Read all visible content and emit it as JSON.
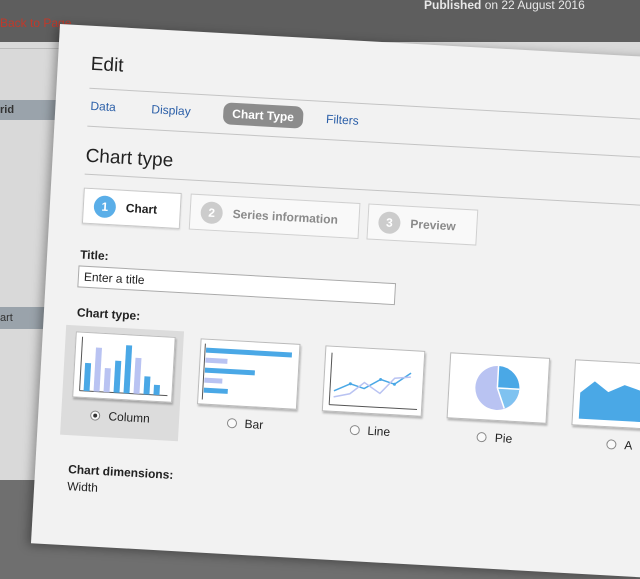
{
  "background": {
    "back_link": "Back to Page",
    "published_status": "Published",
    "published_date": "on 22 August 2016",
    "row_label_1": "rid",
    "row_label_2": "art"
  },
  "modal": {
    "title": "Edit",
    "tabs": [
      {
        "label": "Data",
        "active": false
      },
      {
        "label": "Display",
        "active": false
      },
      {
        "label": "Chart Type",
        "active": true
      },
      {
        "label": "Filters",
        "active": false
      }
    ],
    "section_title": "Chart type",
    "steps": [
      {
        "number": "1",
        "label": "Chart",
        "active": true
      },
      {
        "number": "2",
        "label": "Series information",
        "active": false
      },
      {
        "number": "3",
        "label": "Preview",
        "active": false
      }
    ],
    "title_field": {
      "label": "Title:",
      "placeholder": "Enter a title",
      "value": ""
    },
    "chart_type": {
      "label": "Chart type:",
      "selected": "Column",
      "options": [
        {
          "label": "Column",
          "icon": "column-chart-icon",
          "selected": true
        },
        {
          "label": "Bar",
          "icon": "bar-chart-icon",
          "selected": false
        },
        {
          "label": "Line",
          "icon": "line-chart-icon",
          "selected": false
        },
        {
          "label": "Pie",
          "icon": "pie-chart-icon",
          "selected": false
        },
        {
          "label": "A",
          "icon": "area-chart-icon",
          "selected": false
        }
      ]
    },
    "dimensions": {
      "label": "Chart dimensions:",
      "width_label": "Width"
    }
  },
  "colors": {
    "accent": "#5aaee8",
    "chart_blue": "#4aa8e6",
    "chart_light": "#b9c3f2",
    "tab_active_bg": "#8c8c8c",
    "link": "#2b5fa8",
    "back_link": "#c0392b"
  }
}
